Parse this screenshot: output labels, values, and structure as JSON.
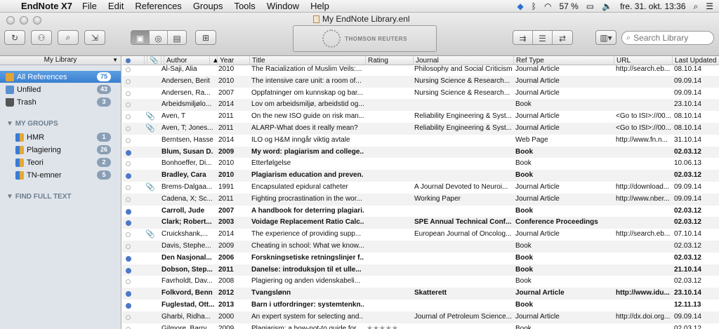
{
  "menubar": {
    "app": "EndNote X7",
    "items": [
      "File",
      "Edit",
      "References",
      "Groups",
      "Tools",
      "Window",
      "Help"
    ],
    "battery": "57 %",
    "datetime": "fre. 31. okt.  13:36"
  },
  "window": {
    "title": "My EndNote Library.enl",
    "banner": "THOMSON REUTERS"
  },
  "search": {
    "placeholder": "Search Library"
  },
  "sidebar": {
    "library_select": "My Library",
    "items": [
      {
        "label": "All References",
        "count": "75",
        "icon": "all-references-icon",
        "color": "#e0a23a"
      },
      {
        "label": "Unfiled",
        "count": "43",
        "icon": "unfiled-icon",
        "color": "#5a8fd0"
      },
      {
        "label": "Trash",
        "count": "3",
        "icon": "trash-icon",
        "color": "#555555"
      }
    ],
    "my_groups_heading": "MY GROUPS",
    "groups": [
      {
        "label": "HMR",
        "count": "1"
      },
      {
        "label": "Plagiering",
        "count": "26"
      },
      {
        "label": "Teori",
        "count": "2"
      },
      {
        "label": "TN-emner",
        "count": "5"
      }
    ],
    "find_full_text_heading": "FIND FULL TEXT"
  },
  "table": {
    "columns": [
      "Author",
      "Year",
      "Title",
      "Rating",
      "Journal",
      "Ref Type",
      "URL",
      "Last Updated"
    ],
    "rows": [
      {
        "unread": false,
        "attach": false,
        "author": "Al-Saji, Alia",
        "year": "2010",
        "title": "The Racialization of Muslim Veils:...",
        "rating": "",
        "journal": "Philosophy and Social Criticism",
        "reftype": "Journal Article",
        "url": "http://search.eb...",
        "updated": "08.10.14"
      },
      {
        "unread": false,
        "attach": false,
        "author": "Andersen, Berit",
        "year": "2010",
        "title": "The intensive care unit: a room of...",
        "rating": "",
        "journal": "Nursing Science & Research...",
        "reftype": "Journal Article",
        "url": "",
        "updated": "09.09.14"
      },
      {
        "unread": false,
        "attach": false,
        "author": "Andersen, Ra...",
        "year": "2007",
        "title": "Oppfatninger om kunnskap og bar...",
        "rating": "",
        "journal": "Nursing Science & Research...",
        "reftype": "Journal Article",
        "url": "",
        "updated": "09.09.14"
      },
      {
        "unread": false,
        "attach": false,
        "author": "Arbeidsmiljølo...",
        "year": "2014",
        "title": "Lov om arbeidsmiljø, arbeidstid og...",
        "rating": "",
        "journal": "",
        "reftype": "Book",
        "url": "",
        "updated": "23.10.14"
      },
      {
        "unread": false,
        "attach": true,
        "author": "Aven, T",
        "year": "2011",
        "title": "On the new ISO guide on risk man...",
        "rating": "",
        "journal": "Reliability Engineering & Syst...",
        "reftype": "Journal Article",
        "url": "<Go to ISI>://00...",
        "updated": "08.10.14"
      },
      {
        "unread": false,
        "attach": true,
        "author": "Aven, T; Jones...",
        "year": "2011",
        "title": "ALARP-What does it really mean?",
        "rating": "",
        "journal": "Reliability Engineering & Syst...",
        "reftype": "Journal Article",
        "url": "<Go to ISI>://00...",
        "updated": "08.10.14"
      },
      {
        "unread": false,
        "attach": false,
        "author": "Berntsen, Hasse",
        "year": "2014",
        "title": "ILO og H&M inngår viktig avtale",
        "rating": "",
        "journal": "",
        "reftype": "Web Page",
        "url": "http://www.fn.n...",
        "updated": "31.10.14"
      },
      {
        "unread": true,
        "attach": false,
        "author": "Blum, Susan D.",
        "year": "2009",
        "title": "My word: plagiarism and college...",
        "rating": "",
        "journal": "",
        "reftype": "Book",
        "url": "",
        "updated": "02.03.12"
      },
      {
        "unread": false,
        "attach": false,
        "author": "Bonhoeffer, Di...",
        "year": "2010",
        "title": "Etterfølgelse",
        "rating": "",
        "journal": "",
        "reftype": "Book",
        "url": "",
        "updated": "10.06.13"
      },
      {
        "unread": true,
        "attach": false,
        "author": "Bradley, Cara",
        "year": "2010",
        "title": "Plagiarism education and preven...",
        "rating": "",
        "journal": "",
        "reftype": "Book",
        "url": "",
        "updated": "02.03.12"
      },
      {
        "unread": false,
        "attach": true,
        "author": "Brems-Dalgaa...",
        "year": "1991",
        "title": "Encapsulated epidural catheter",
        "rating": "",
        "journal": "A Journal Devoted to Neuroi...",
        "reftype": "Journal Article",
        "url": "http://download...",
        "updated": "09.09.14"
      },
      {
        "unread": false,
        "attach": false,
        "author": "Cadena, X; Sc...",
        "year": "2011",
        "title": "Fighting procrastination in the wor...",
        "rating": "",
        "journal": "Working Paper",
        "reftype": "Journal Article",
        "url": "http://www.nber...",
        "updated": "09.09.14"
      },
      {
        "unread": true,
        "attach": false,
        "author": "Carroll, Jude",
        "year": "2007",
        "title": "A handbook for deterring plagiari...",
        "rating": "",
        "journal": "",
        "reftype": "Book",
        "url": "",
        "updated": "02.03.12"
      },
      {
        "unread": true,
        "attach": false,
        "author": "Clark; Robert...",
        "year": "2003",
        "title": "Voidage Replacement Ratio Calc...",
        "rating": "",
        "journal": "SPE Annual Technical Conf...",
        "reftype": "Conference Proceedings",
        "url": "",
        "updated": "02.03.12"
      },
      {
        "unread": false,
        "attach": true,
        "author": "Cruickshank,...",
        "year": "2014",
        "title": "The experience of providing supp...",
        "rating": "",
        "journal": "European Journal of Oncolog...",
        "reftype": "Journal Article",
        "url": "http://search.eb...",
        "updated": "07.10.14"
      },
      {
        "unread": false,
        "attach": false,
        "author": "Davis, Stephe...",
        "year": "2009",
        "title": "Cheating in school: What we know...",
        "rating": "",
        "journal": "",
        "reftype": "Book",
        "url": "",
        "updated": "02.03.12"
      },
      {
        "unread": true,
        "attach": false,
        "author": "Den Nasjonal...",
        "year": "2006",
        "title": "Forskningsetiske retningslinjer f...",
        "rating": "",
        "journal": "",
        "reftype": "Book",
        "url": "",
        "updated": "02.03.12"
      },
      {
        "unread": true,
        "attach": false,
        "author": "Dobson, Step...",
        "year": "2011",
        "title": "Danelse: introduksjon til et ulle...",
        "rating": "",
        "journal": "",
        "reftype": "Book",
        "url": "",
        "updated": "21.10.14"
      },
      {
        "unread": false,
        "attach": false,
        "author": "Favrholdt, Dav...",
        "year": "2008",
        "title": "Plagiering og anden videnskabeli...",
        "rating": "",
        "journal": "",
        "reftype": "Book",
        "url": "",
        "updated": "02.03.12"
      },
      {
        "unread": true,
        "attach": false,
        "author": "Folkvord, Benn",
        "year": "2012",
        "title": "Tvangslønn",
        "rating": "",
        "journal": "Skatterett",
        "reftype": "Journal Article",
        "url": "http://www.idu...",
        "updated": "23.10.14"
      },
      {
        "unread": true,
        "attach": false,
        "author": "Fuglestad, Ott...",
        "year": "2013",
        "title": "Barn i utfordringer: systemtenkn...",
        "rating": "",
        "journal": "",
        "reftype": "Book",
        "url": "",
        "updated": "12.11.13"
      },
      {
        "unread": false,
        "attach": false,
        "author": "Gharbi, Ridha...",
        "year": "2000",
        "title": "An expert system for selecting and...",
        "rating": "",
        "journal": "Journal of Petroleum Science...",
        "reftype": "Journal Article",
        "url": "http://dx.doi.org...",
        "updated": "09.09.14"
      },
      {
        "unread": false,
        "attach": false,
        "author": "Gilmore, Barry",
        "year": "2009",
        "title": "Plagiarism: a how-not-to guide for...",
        "rating": "★★★★★",
        "journal": "",
        "reftype": "Book",
        "url": "",
        "updated": "02.03.12"
      }
    ]
  }
}
